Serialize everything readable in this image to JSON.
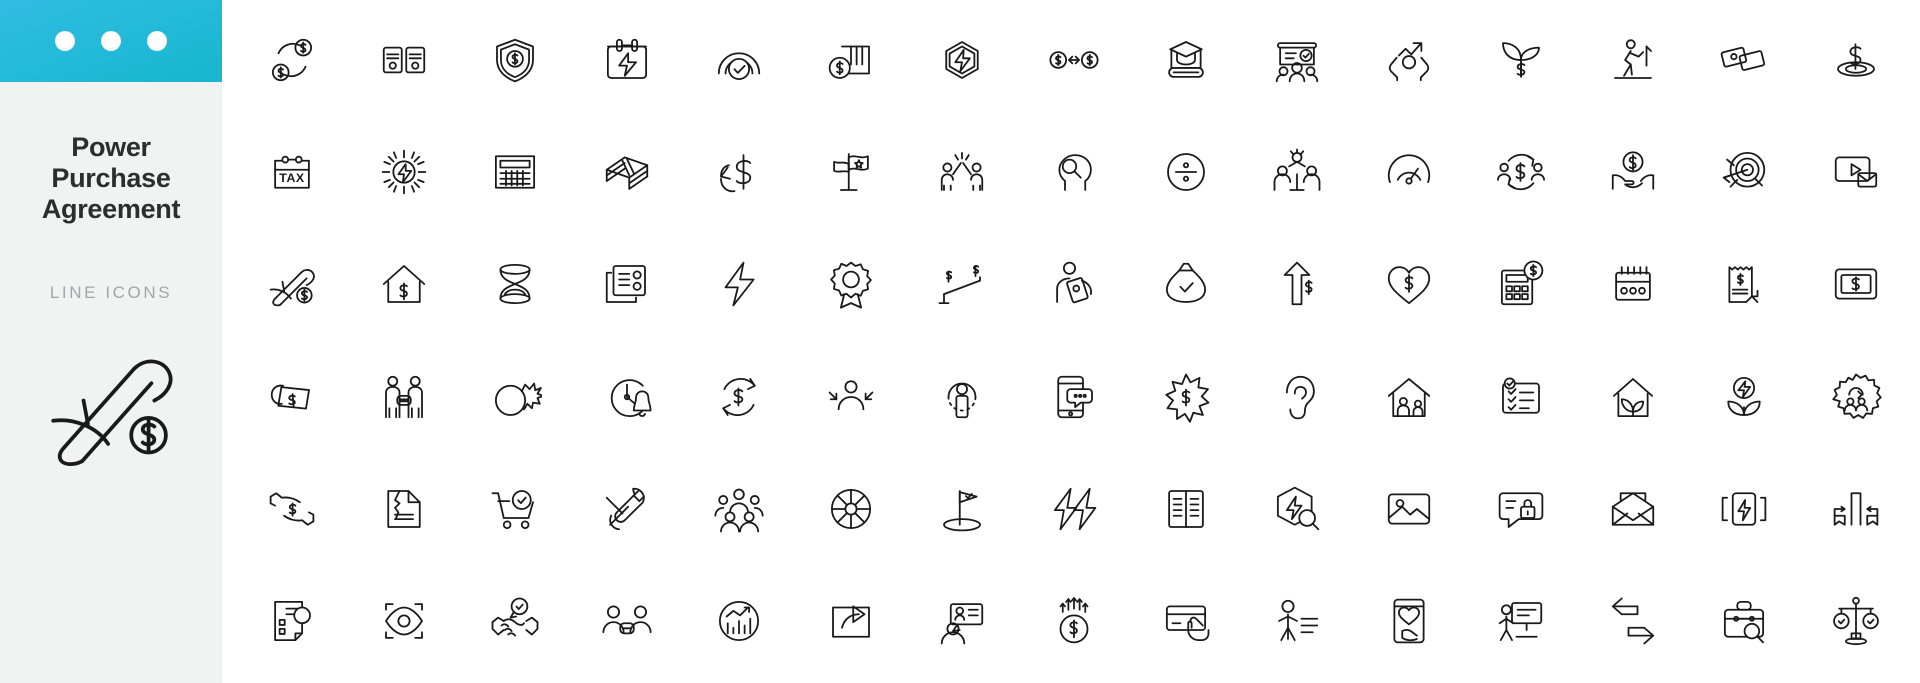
{
  "sidebar": {
    "header_dots": [
      "dot-1",
      "dot-2",
      "dot-3"
    ],
    "title": "Power Purchase Agreement",
    "title_lines": [
      "Power",
      "Purchase",
      "Agreement"
    ],
    "subtitle": "LINE ICONS",
    "feature_icon": "rolled-document-dollar-icon",
    "background_color": "#f1f2f2",
    "header_gradient_from": "#30bde3",
    "header_gradient_to": "#17b6cf",
    "title_color": "#2d2d2d",
    "subtitle_color": "#a3a5a7"
  },
  "grid": {
    "columns": 15,
    "rows": 6,
    "stroke_color": "#1a1a1a",
    "background_color": "#ffffff",
    "icons": [
      "money-exchange-circle-icon",
      "dual-server-document-icon",
      "shield-dollar-icon",
      "energy-calendar-icon",
      "rainbow-check-icon",
      "coin-barcode-icon",
      "hexagon-bolt-icon",
      "dollar-exchange-arrows-icon",
      "graduation-book-icon",
      "presentation-check-audience-icon",
      "hands-growth-arrow-icon",
      "plant-dollar-icon",
      "hiking-growth-icon",
      "two-banknotes-icon",
      "dollar-pit-icon",
      "tax-board-icon",
      "solar-energy-bolt-icon",
      "calculator-icon",
      "cash-stack-icon",
      "dollar-return-arrow-icon",
      "star-flag-icon",
      "high-five-team-icon",
      "head-search-icon",
      "coin-divide-icon",
      "team-gear-success-icon",
      "gauge-meter-icon",
      "money-transfer-people-icon",
      "hand-coin-icon",
      "target-arrow-icon",
      "video-mail-icon",
      "rolled-document-dollar-icon",
      "house-dollar-icon",
      "hourglass-icon",
      "document-list-icon",
      "lightning-bolt-icon",
      "award-badge-icon",
      "dollar-balance-scale-icon",
      "person-banknotes-icon",
      "money-bag-check-icon",
      "up-arrow-dollar-icon",
      "heart-dollar-icon",
      "calculator-dollar-icon",
      "abacus-icon",
      "receipt-dollar-icon",
      "dollar-screen-icon",
      "price-tag-dollar-icon",
      "two-people-chat-icon",
      "bomb-explosion-icon",
      "alarm-bell-timer-icon",
      "dollar-refresh-icon",
      "person-arrows-focus-icon",
      "person-circle-icon",
      "mobile-chat-icon",
      "burst-dollar-icon",
      "ear-listen-icon",
      "house-people-icon",
      "checklist-clipboard-icon",
      "house-leaf-icon",
      "energy-leaf-icon",
      "gear-people-icon",
      "hands-exchange-dollar-icon",
      "torn-document-icon",
      "cart-check-icon",
      "wrench-tools-icon",
      "people-group-icon",
      "pie-wheel-icon",
      "flag-check-goal-icon",
      "double-bolt-icon",
      "open-book-icon",
      "hexagon-bolt-search-icon",
      "image-picture-icon",
      "chat-lock-icon",
      "open-envelope-icon",
      "bracket-bolt-icon",
      "bar-trend-arrows-icon",
      "report-search-icon",
      "eye-scan-icon",
      "handshake-check-icon",
      "people-minus-icon",
      "circle-bar-chart-icon",
      "share-arrow-box-icon",
      "id-card-person-icon",
      "dollar-growth-arrows-icon",
      "hand-card-payment-icon",
      "person-minus-list-icon",
      "mobile-heart-hand-icon",
      "presentation-person-icon",
      "two-way-arrows-icon",
      "briefcase-search-icon",
      "balance-check-scale-icon"
    ]
  }
}
